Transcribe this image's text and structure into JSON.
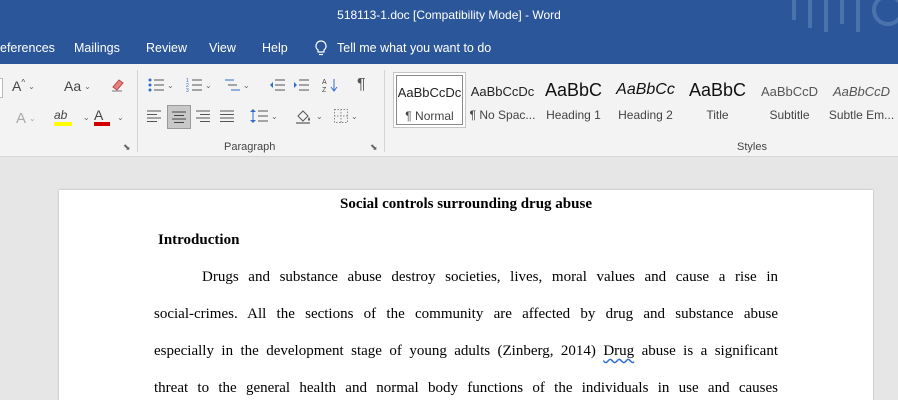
{
  "window": {
    "title": "518113-1.doc [Compatibility Mode]  -  Word"
  },
  "menu": {
    "tabs": [
      "eferences",
      "Mailings",
      "Review",
      "View",
      "Help"
    ],
    "tell_me": "Tell me what you want to do"
  },
  "ribbon": {
    "font_size_up": "A",
    "case_label": "Aa",
    "highlight_label": "ab",
    "font_color_label": "A",
    "effects_label": "A",
    "paragraph_group": "Paragraph",
    "styles_group": "Styles",
    "styles": [
      {
        "preview": "AaBbCcDc",
        "name": "¶ Normal"
      },
      {
        "preview": "AaBbCcDc",
        "name": "¶ No Spac..."
      },
      {
        "preview": "AaBbC",
        "name": "Heading 1"
      },
      {
        "preview": "AaBbCc",
        "name": "Heading 2"
      },
      {
        "preview": "AaBbC",
        "name": "Title"
      },
      {
        "preview": "AaBbCcD",
        "name": "Subtitle"
      },
      {
        "preview": "AaBbCcD",
        "name": "Subtle Em..."
      }
    ]
  },
  "document": {
    "title": "Social controls surrounding drug abuse",
    "heading": "Introduction",
    "lines": [
      "Drugs and substance abuse destroy societies, lives, moral values and cause a rise in",
      "social-crimes. All the sections of the community are affected by drug and substance abuse",
      "especially in the development stage of young adults (Zinberg, 2014)",
      "Drug",
      "abuse is a significant",
      "threat to the general health and normal body functions of the individuals in use and causes"
    ]
  },
  "colors": {
    "accent": "#2b579a",
    "ribbon_bg": "#f3f3f3",
    "canvas": "#e6e6e6",
    "font_color_bar": "#d00000",
    "highlight_bar": "#ffff00"
  }
}
